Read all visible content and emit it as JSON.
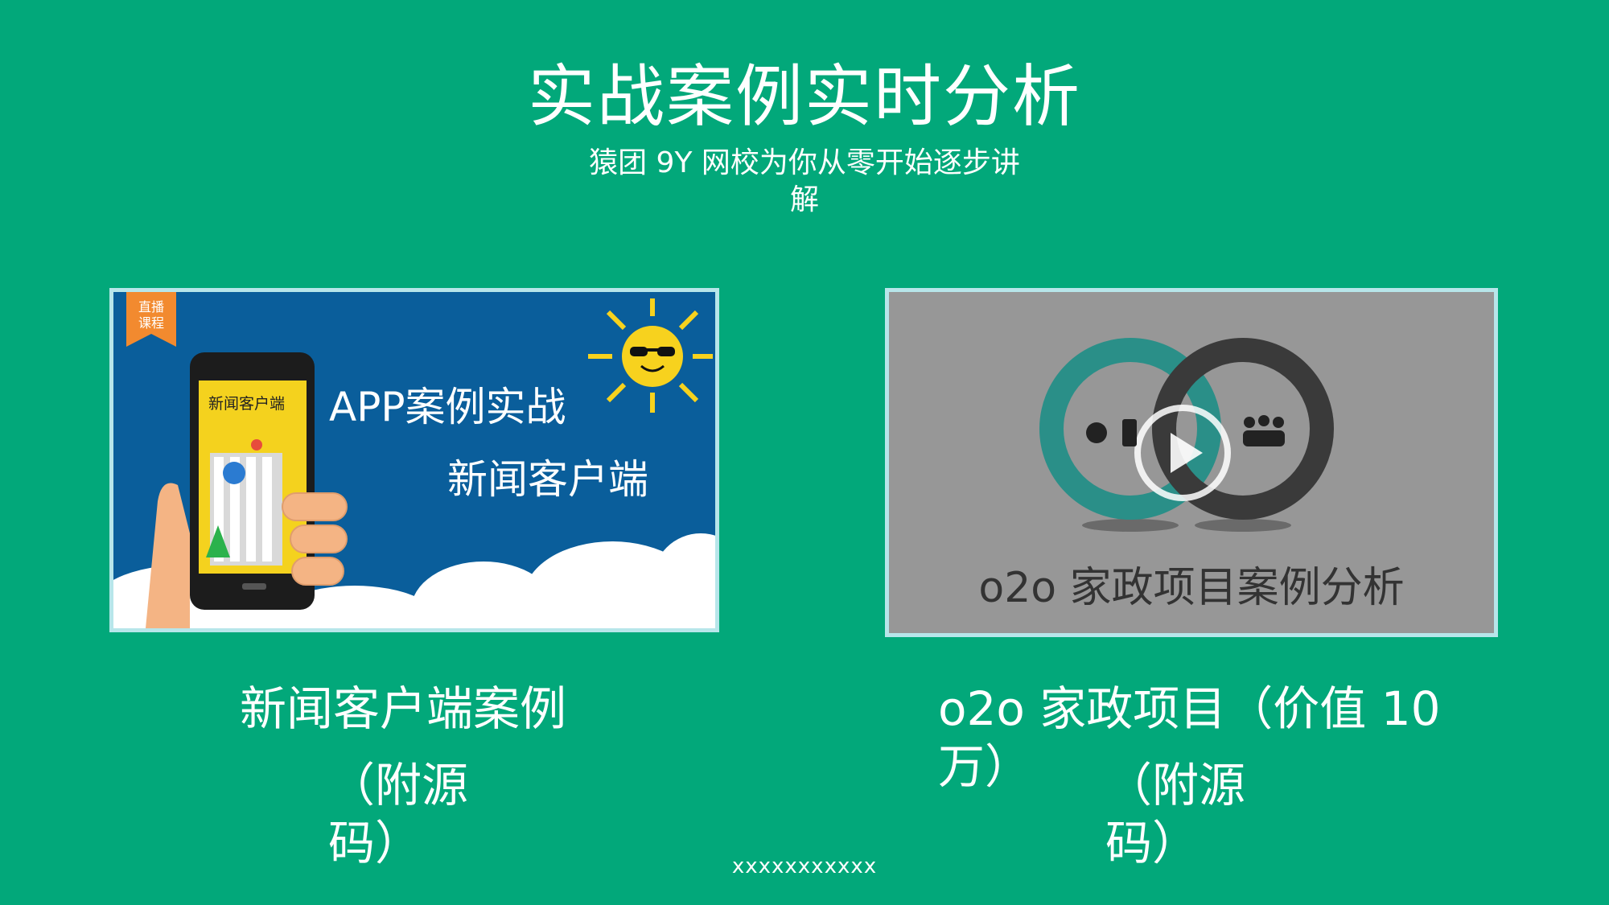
{
  "slide": {
    "title": "实战案例实时分析",
    "subtitle": "猿团 9Y 网校为你从零开始逐步讲解",
    "footer": "xxxxxxxxxxx"
  },
  "card1": {
    "badge": "直播课程",
    "headline": "APP案例实战",
    "subline": "新闻客户端",
    "phone_screen_title": "新闻客户端"
  },
  "card2": {
    "caption": "o2o 家政项目案例分析",
    "play_icon": "play-icon"
  },
  "labels": {
    "left_line1": "新闻客户端案例",
    "left_line2": "（附源码）",
    "right_line1": "o2o 家政项目（价值 10 万）",
    "right_line2": "（附源码）"
  },
  "colors": {
    "background": "#02a87a",
    "card_border": "#b7e6ea",
    "card1_bg": "#0a5e9b",
    "card2_bg": "#979797",
    "badge": "#f28a2f",
    "sun": "#f7d21e",
    "teal_ring": "#2a8f88"
  }
}
